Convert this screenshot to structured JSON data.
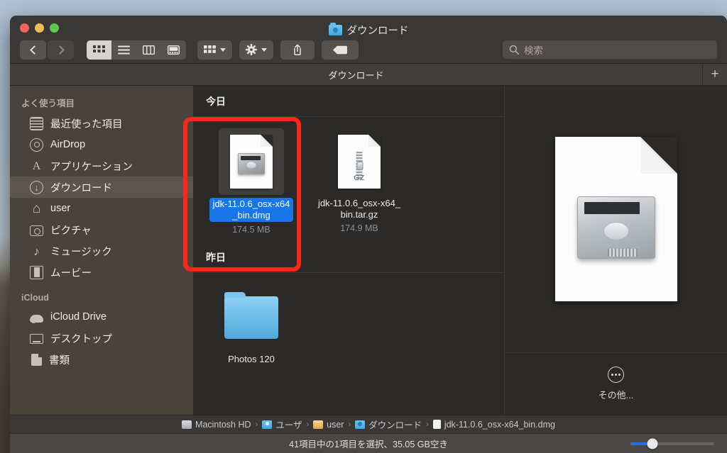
{
  "window": {
    "title": "ダウンロード",
    "title_icon": "downloads-folder-icon",
    "traffic_lights": [
      "close",
      "minimize",
      "zoom"
    ]
  },
  "toolbar": {
    "back_label": "‹",
    "forward_label": "›",
    "view_buttons": [
      {
        "name": "icon-view",
        "label": "▦",
        "active": true
      },
      {
        "name": "list-view",
        "label": "☰",
        "active": false
      },
      {
        "name": "column-view",
        "label": "◫",
        "active": false
      },
      {
        "name": "gallery-view",
        "label": "▤",
        "active": false
      }
    ],
    "group_button": "▦",
    "action_button": "⚙",
    "share_button": "⬆",
    "tag_button": "⬤"
  },
  "search": {
    "placeholder": "検索",
    "icon": "search-icon"
  },
  "tabs": {
    "items": [
      {
        "label": "ダウンロード",
        "active": true
      }
    ],
    "add_label": "+"
  },
  "sidebar": {
    "sections": [
      {
        "header": "よく使う項目",
        "items": [
          {
            "label": "最近使った項目",
            "icon": "recents-icon",
            "selected": false
          },
          {
            "label": "AirDrop",
            "icon": "airdrop-icon",
            "selected": false
          },
          {
            "label": "アプリケーション",
            "icon": "applications-icon",
            "selected": false
          },
          {
            "label": "ダウンロード",
            "icon": "downloads-icon",
            "selected": true
          },
          {
            "label": "user",
            "icon": "home-icon",
            "selected": false
          },
          {
            "label": "ピクチャ",
            "icon": "pictures-icon",
            "selected": false
          },
          {
            "label": "ミュージック",
            "icon": "music-icon",
            "selected": false
          },
          {
            "label": "ムービー",
            "icon": "movies-icon",
            "selected": false
          }
        ]
      },
      {
        "header": "iCloud",
        "items": [
          {
            "label": "iCloud Drive",
            "icon": "icloud-icon",
            "selected": false
          },
          {
            "label": "デスクトップ",
            "icon": "desktop-icon",
            "selected": false
          },
          {
            "label": "書類",
            "icon": "documents-icon",
            "selected": false
          }
        ]
      }
    ]
  },
  "files": {
    "groups": [
      {
        "title": "今日",
        "items": [
          {
            "name": "jdk-11.0.6_osx-x64_bin.dmg",
            "size": "174.5 MB",
            "icon": "dmg-disk-image-icon",
            "selected": true
          },
          {
            "name": "jdk-11.0.6_osx-x64_bin.tar.gz",
            "size": "174.9 MB",
            "icon": "gz-archive-icon",
            "badge": "GZ",
            "selected": false
          }
        ]
      },
      {
        "title": "昨日",
        "items": [
          {
            "name": "Photos 120",
            "size": "",
            "icon": "folder-icon",
            "selected": false
          }
        ]
      }
    ]
  },
  "preview": {
    "icon": "dmg-disk-image-preview",
    "more_label": "その他...",
    "more_icon": "ellipsis-circle-icon"
  },
  "pathbar": {
    "crumbs": [
      {
        "label": "Macintosh HD",
        "icon": "harddisk-icon"
      },
      {
        "label": "ユーザ",
        "icon": "users-folder-icon"
      },
      {
        "label": "user",
        "icon": "home-folder-icon"
      },
      {
        "label": "ダウンロード",
        "icon": "downloads-folder-icon"
      },
      {
        "label": "jdk-11.0.6_osx-x64_bin.dmg",
        "icon": "dmg-file-icon"
      }
    ],
    "separator": "›"
  },
  "statusbar": {
    "text": "41項目中の1項目を選択、35.05 GB空き",
    "zoom_slider_value": 26
  },
  "annotation": {
    "color": "#fb2719",
    "target": "jdk-11.0.6_osx-x64_bin.dmg"
  }
}
